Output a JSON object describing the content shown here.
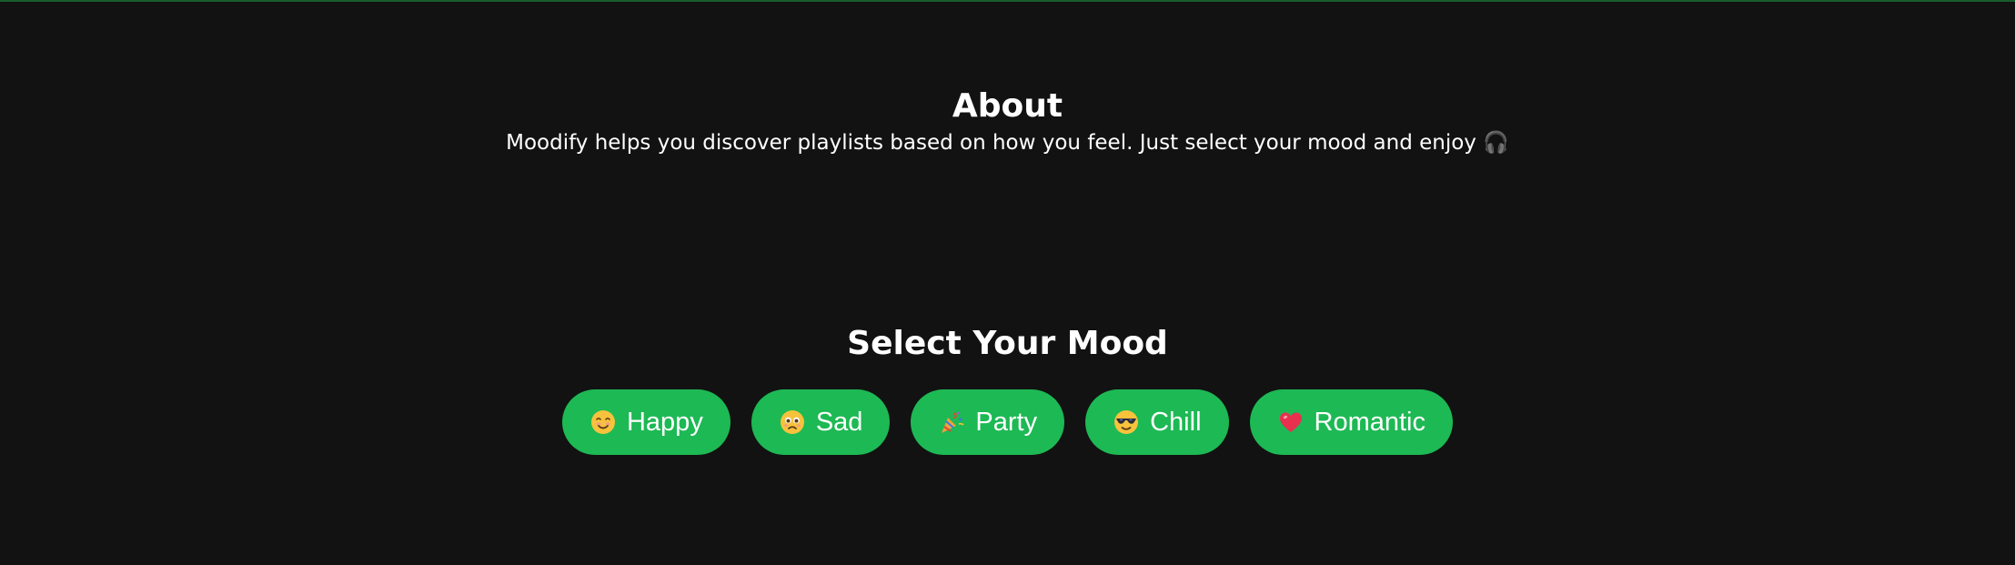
{
  "about": {
    "title": "About",
    "text": "Moodify helps you discover playlists based on how you feel. Just select your mood and enjoy 🎧"
  },
  "mood_section": {
    "title": "Select Your Mood",
    "buttons": [
      {
        "label": "Happy",
        "icon": "smiling-face-icon"
      },
      {
        "label": "Sad",
        "icon": "sad-face-icon"
      },
      {
        "label": "Party",
        "icon": "party-popper-icon"
      },
      {
        "label": "Chill",
        "icon": "sunglasses-face-icon"
      },
      {
        "label": "Romantic",
        "icon": "heart-icon"
      }
    ]
  },
  "colors": {
    "background": "#121212",
    "accent": "#1db954",
    "text": "#ffffff"
  }
}
